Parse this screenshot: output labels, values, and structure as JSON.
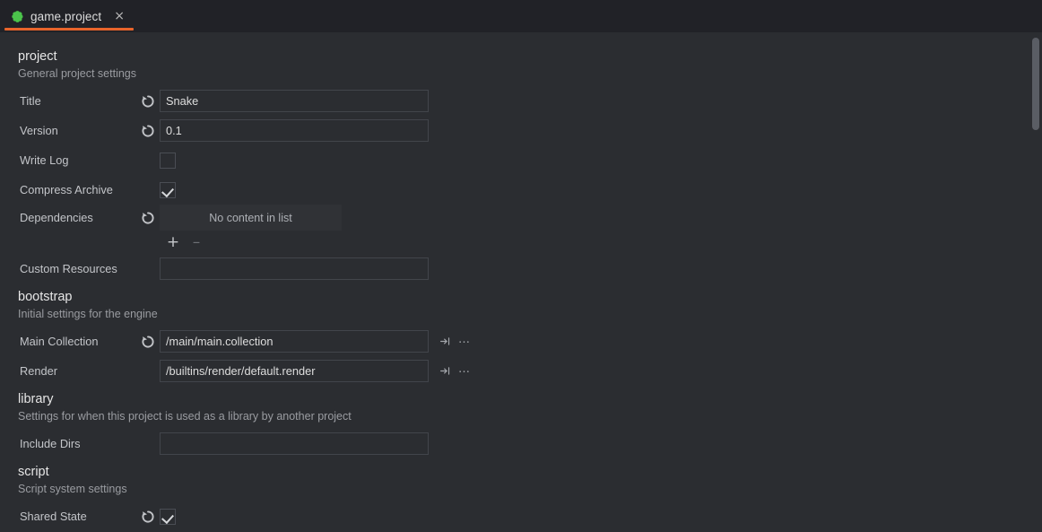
{
  "window": {
    "tab": {
      "label": "game.project",
      "icon": "defold-project-icon",
      "close_label": "×",
      "accent_color": "#e8642b",
      "icon_color": "#4bc34b"
    }
  },
  "sections": [
    {
      "id": "project",
      "title": "project",
      "description": "General project settings",
      "rows": [
        {
          "id": "title",
          "label": "Title",
          "type": "text",
          "value": "Snake",
          "reset": true
        },
        {
          "id": "version",
          "label": "Version",
          "type": "text",
          "value": "0.1",
          "reset": true
        },
        {
          "id": "write-log",
          "label": "Write Log",
          "type": "checkbox",
          "checked": false,
          "reset": false
        },
        {
          "id": "compress-archive",
          "label": "Compress Archive",
          "type": "checkbox",
          "checked": true,
          "reset": false
        },
        {
          "id": "dependencies",
          "label": "Dependencies",
          "type": "list",
          "empty_text": "No content in list",
          "reset": true,
          "add_label": "+",
          "remove_label": "–"
        },
        {
          "id": "custom-resources",
          "label": "Custom Resources",
          "type": "text",
          "value": "",
          "reset": false
        }
      ]
    },
    {
      "id": "bootstrap",
      "title": "bootstrap",
      "description": "Initial settings for the engine",
      "rows": [
        {
          "id": "main-collection",
          "label": "Main Collection",
          "type": "path",
          "value": "/main/main.collection",
          "reset": true,
          "jump_icon": "jump-to-icon",
          "more_label": "…"
        },
        {
          "id": "render",
          "label": "Render",
          "type": "path",
          "value": "/builtins/render/default.render",
          "reset": false,
          "jump_icon": "jump-to-icon",
          "more_label": "…"
        }
      ]
    },
    {
      "id": "library",
      "title": "library",
      "description": "Settings for when this project is used as a library by another project",
      "rows": [
        {
          "id": "include-dirs",
          "label": "Include Dirs",
          "type": "text",
          "value": "",
          "reset": false
        }
      ]
    },
    {
      "id": "script",
      "title": "script",
      "description": "Script system settings",
      "rows": [
        {
          "id": "shared-state",
          "label": "Shared State",
          "type": "checkbox",
          "checked": true,
          "reset": true
        }
      ]
    }
  ],
  "scrollbar": {
    "name": "vertical-scrollbar"
  }
}
